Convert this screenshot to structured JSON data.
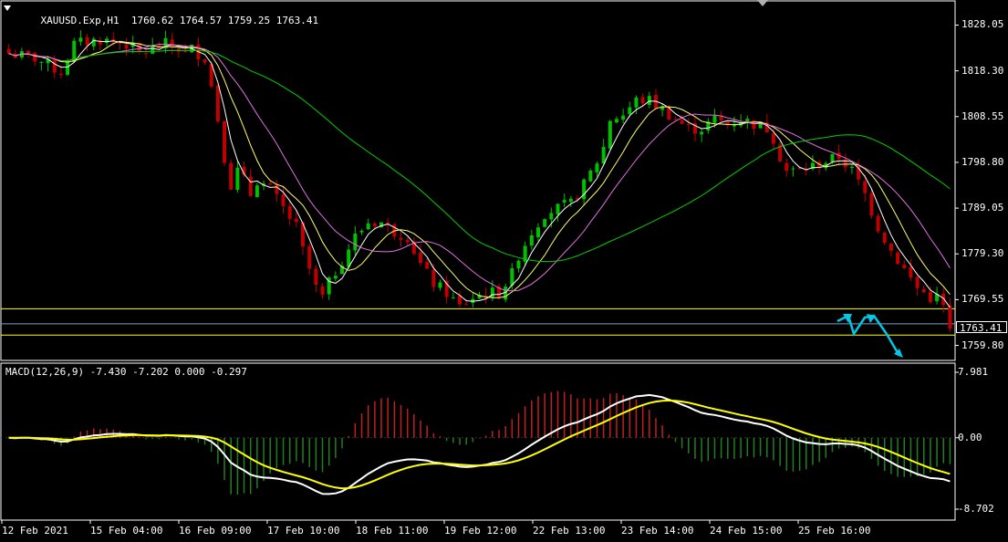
{
  "header": {
    "symbol": "XAUUSD.Exp,H1",
    "ohlc": "1760.62 1764.57 1759.25 1763.41"
  },
  "macd_header": {
    "text": "MACD(12,26,9) -7.430 -7.202 0.000 -0.297"
  },
  "current_price": "1763.41",
  "colors": {
    "bull": "#00c000",
    "bear": "#c00000",
    "ma_fast": "#ffffff",
    "ma_mid": "#ffff66",
    "ma_slow": "#e070e0",
    "ma_long": "#00d000",
    "levels": "#ffff00",
    "arrows": "#00c8e8",
    "macd_main": "#ffffff",
    "macd_signal": "#ffff00"
  },
  "chart_data": [
    {
      "type": "candlestick",
      "title": "XAUUSD.Exp,H1",
      "y_ticks": [
        "1828.05",
        "1818.30",
        "1808.55",
        "1798.80",
        "1789.05",
        "1779.30",
        "1769.55",
        "1759.80"
      ],
      "ylim": [
        1756.6,
        1833.2
      ],
      "x_ticks": [
        "12 Feb 2021",
        "15 Feb 04:00",
        "16 Feb 09:00",
        "17 Feb 10:00",
        "18 Feb 11:00",
        "19 Feb 12:00",
        "22 Feb 13:00",
        "23 Feb 14:00",
        "24 Feb 15:00",
        "25 Feb 16:00"
      ],
      "close_path": [
        [
          0,
          1822
        ],
        [
          4,
          1821
        ],
        [
          8,
          1818
        ],
        [
          10,
          1824
        ],
        [
          14,
          1825
        ],
        [
          18,
          1824
        ],
        [
          20,
          1822
        ],
        [
          22,
          1823
        ],
        [
          24,
          1824
        ],
        [
          26,
          1823
        ],
        [
          27,
          1822
        ],
        [
          28,
          1823
        ],
        [
          30,
          1821
        ],
        [
          31,
          1815
        ],
        [
          32,
          1808
        ],
        [
          33,
          1800
        ],
        [
          34,
          1794
        ],
        [
          35,
          1797
        ],
        [
          36,
          1795
        ],
        [
          37,
          1792
        ],
        [
          38,
          1795
        ],
        [
          40,
          1793
        ],
        [
          42,
          1789
        ],
        [
          44,
          1785
        ],
        [
          45,
          1780
        ],
        [
          46,
          1776
        ],
        [
          47,
          1772
        ],
        [
          48,
          1770
        ],
        [
          49,
          1773
        ],
        [
          51,
          1778
        ],
        [
          53,
          1783
        ],
        [
          55,
          1786
        ],
        [
          57,
          1786
        ],
        [
          59,
          1784
        ],
        [
          61,
          1783
        ],
        [
          63,
          1777
        ],
        [
          65,
          1773
        ],
        [
          67,
          1771
        ],
        [
          69,
          1768
        ],
        [
          71,
          1770
        ],
        [
          73,
          1771
        ],
        [
          75,
          1771
        ],
        [
          76,
          1773
        ],
        [
          77,
          1775
        ],
        [
          78,
          1779
        ],
        [
          80,
          1784
        ],
        [
          82,
          1788
        ],
        [
          84,
          1789
        ],
        [
          86,
          1790
        ],
        [
          88,
          1794
        ],
        [
          90,
          1799
        ],
        [
          91,
          1802
        ],
        [
          92,
          1808
        ],
        [
          94,
          1809
        ],
        [
          96,
          1812
        ],
        [
          98,
          1812
        ],
        [
          100,
          1810
        ],
        [
          102,
          1808
        ],
        [
          104,
          1806
        ],
        [
          106,
          1806
        ],
        [
          108,
          1808
        ],
        [
          110,
          1807
        ],
        [
          112,
          1808
        ],
        [
          114,
          1807
        ],
        [
          116,
          1806
        ],
        [
          117,
          1804
        ],
        [
          118,
          1800
        ],
        [
          119,
          1797
        ],
        [
          121,
          1797
        ],
        [
          123,
          1798
        ],
        [
          125,
          1799
        ],
        [
          127,
          1800
        ],
        [
          129,
          1797
        ],
        [
          131,
          1792
        ],
        [
          133,
          1785
        ],
        [
          135,
          1780
        ],
        [
          137,
          1776
        ],
        [
          139,
          1772
        ],
        [
          141,
          1770
        ],
        [
          142,
          1770
        ],
        [
          143,
          1768
        ],
        [
          144,
          1763.41
        ]
      ],
      "levels": [
        1767.6,
        1764.4,
        1762.0
      ],
      "moving_averages": {
        "fast": "white",
        "mid": "yellow",
        "slow": "violet",
        "long": "green"
      },
      "grid": false,
      "legend": "none"
    },
    {
      "type": "macd",
      "title": "MACD(12,26,9)",
      "series": [
        {
          "name": "MACD main",
          "value": -7.43
        },
        {
          "name": "Signal",
          "value": -7.202
        },
        {
          "value": 0.0
        },
        {
          "name": "Histogram",
          "value": -0.297
        }
      ],
      "y_ticks": [
        "7.981",
        "0.00",
        "-8.702"
      ],
      "ylim": [
        -8.702,
        7.981
      ]
    }
  ]
}
